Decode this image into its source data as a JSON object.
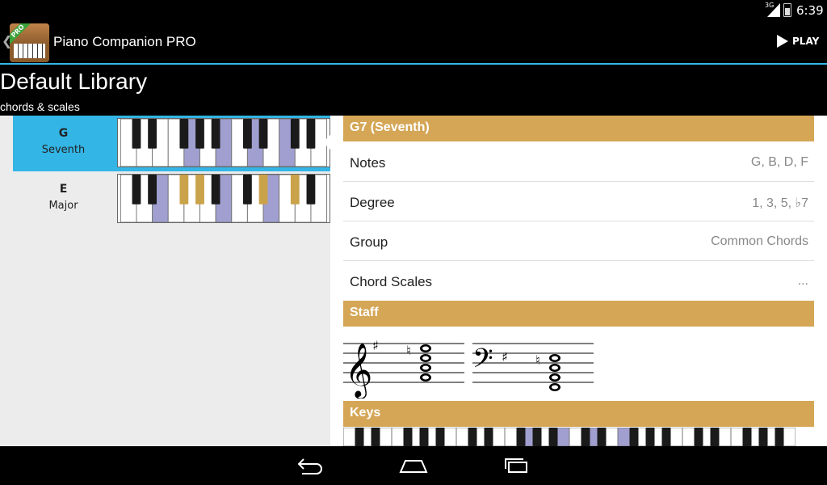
{
  "status": {
    "network": "3G",
    "time": "6:39"
  },
  "app": {
    "title": "Piano Companion PRO",
    "badge": "PRO",
    "play_label": "PLAY"
  },
  "library": {
    "title": "Default Library",
    "subtitle": "chords & scales"
  },
  "list": [
    {
      "name": "G",
      "kind": "Seventh",
      "selected": true,
      "highlight_white": [
        4,
        6,
        8,
        10
      ],
      "highlight_black": [],
      "gold_black": []
    },
    {
      "name": "E",
      "kind": "Major",
      "selected": false,
      "highlight_white": [
        2,
        6,
        9
      ],
      "highlight_black": [],
      "gold_black": [
        2,
        3,
        6,
        7
      ]
    }
  ],
  "detail": {
    "chord_title": "G7 (Seventh)",
    "rows": [
      {
        "label": "Notes",
        "value": "G, B, D, F"
      },
      {
        "label": "Degree",
        "value": "1, 3, 5, ♭7"
      },
      {
        "label": "Group",
        "value": "Common Chords"
      },
      {
        "label": "Chord Scales",
        "value": "..."
      }
    ],
    "staff_title": "Staff",
    "keys_title": "Keys",
    "keys_highlight": [
      11,
      13,
      15,
      17
    ]
  },
  "colors": {
    "accent": "#33b5e5",
    "section": "#d4a656",
    "key_highlight": "#a09fd0",
    "key_gold": "#c9a24a"
  }
}
